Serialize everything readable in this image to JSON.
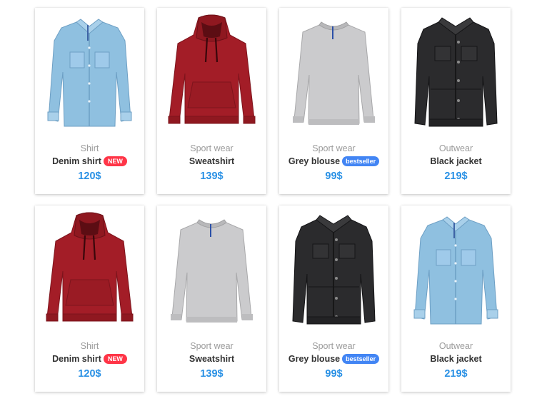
{
  "products": [
    {
      "category": "Shirt",
      "name": "Denim shirt",
      "badge": "NEW",
      "badge_type": "new",
      "price": "120$",
      "image": "denim-shirt"
    },
    {
      "category": "Sport wear",
      "name": "Sweatshirt",
      "badge": "",
      "badge_type": "",
      "price": "139$",
      "image": "red-hoodie"
    },
    {
      "category": "Sport wear",
      "name": "Grey blouse",
      "badge": "bestseller",
      "badge_type": "best",
      "price": "99$",
      "image": "grey-sweater"
    },
    {
      "category": "Outwear",
      "name": "Black jacket",
      "badge": "",
      "badge_type": "",
      "price": "219$",
      "image": "black-jacket"
    },
    {
      "category": "Shirt",
      "name": "Denim shirt",
      "badge": "NEW",
      "badge_type": "new",
      "price": "120$",
      "image": "red-hoodie"
    },
    {
      "category": "Sport wear",
      "name": "Sweatshirt",
      "badge": "",
      "badge_type": "",
      "price": "139$",
      "image": "grey-sweater"
    },
    {
      "category": "Sport wear",
      "name": "Grey blouse",
      "badge": "bestseller",
      "badge_type": "best",
      "price": "99$",
      "image": "black-jacket"
    },
    {
      "category": "Outwear",
      "name": "Black jacket",
      "badge": "",
      "badge_type": "",
      "price": "219$",
      "image": "denim-shirt"
    }
  ],
  "colors": {
    "price": "#2a91e5",
    "badge_new": "#ff3547",
    "badge_bestseller": "#4285f4",
    "category": "#9b9b9b"
  }
}
